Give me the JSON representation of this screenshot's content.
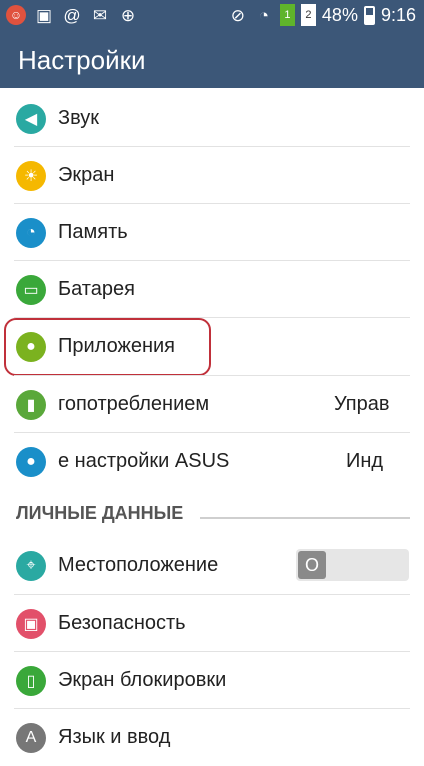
{
  "status_bar": {
    "battery_percent": "48%",
    "time": "9:16",
    "sim1": "1",
    "sim2": "2",
    "battery_level": 0.48
  },
  "app_bar": {
    "title": "Настройки"
  },
  "items": [
    {
      "label": "Звук",
      "icon": "volume-icon",
      "color": "#2aa9a2"
    },
    {
      "label": "Экран",
      "icon": "brightness-icon",
      "color": "#f5b800"
    },
    {
      "label": "Память",
      "icon": "storage-icon",
      "color": "#1a8fc9"
    },
    {
      "label": "Батарея",
      "icon": "battery-icon",
      "color": "#3aa83a"
    },
    {
      "label": "Приложения",
      "icon": "android-icon",
      "color": "#7bb21f"
    },
    {
      "label": "гопотреблением",
      "value": "Управ",
      "icon": "power-icon",
      "color": "#5aa83a"
    },
    {
      "label": "е настройки ASUS",
      "value": "Инд",
      "icon": "asus-settings-icon",
      "color": "#1a8fc9"
    }
  ],
  "section": {
    "title": "ЛИЧНЫЕ ДАННЫЕ"
  },
  "personal_items": [
    {
      "label": "Местоположение",
      "icon": "location-icon",
      "color": "#2aa9a2",
      "toggle": "O"
    },
    {
      "label": "Безопасность",
      "icon": "lock-icon",
      "color": "#e2506a"
    },
    {
      "label": "Экран блокировки",
      "icon": "lockscreen-icon",
      "color": "#3aa83a"
    },
    {
      "label": "Язык и ввод",
      "icon": "language-icon",
      "color": "#777777"
    }
  ],
  "icons": {
    "sb1": "lemon-icon",
    "sb2": "image-icon",
    "sb3": "at-icon",
    "sb4": "mail-icon",
    "sb5": "shield-icon"
  }
}
